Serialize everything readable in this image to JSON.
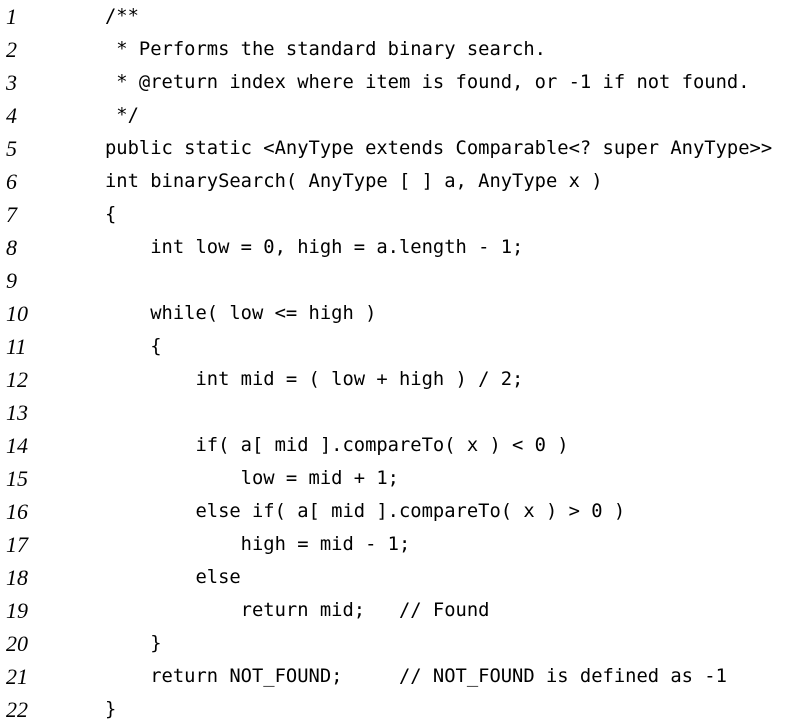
{
  "code_listing": {
    "lines": [
      {
        "number": "1",
        "text": "/**"
      },
      {
        "number": "2",
        "text": " * Performs the standard binary search."
      },
      {
        "number": "3",
        "text": " * @return index where item is found, or -1 if not found."
      },
      {
        "number": "4",
        "text": " */"
      },
      {
        "number": "5",
        "text": "public static <AnyType extends Comparable<? super AnyType>>"
      },
      {
        "number": "6",
        "text": "int binarySearch( AnyType [ ] a, AnyType x )"
      },
      {
        "number": "7",
        "text": "{"
      },
      {
        "number": "8",
        "text": "    int low = 0, high = a.length - 1;"
      },
      {
        "number": "9",
        "text": ""
      },
      {
        "number": "10",
        "text": "    while( low <= high )"
      },
      {
        "number": "11",
        "text": "    {"
      },
      {
        "number": "12",
        "text": "        int mid = ( low + high ) / 2;"
      },
      {
        "number": "13",
        "text": ""
      },
      {
        "number": "14",
        "text": "        if( a[ mid ].compareTo( x ) < 0 )"
      },
      {
        "number": "15",
        "text": "            low = mid + 1;"
      },
      {
        "number": "16",
        "text": "        else if( a[ mid ].compareTo( x ) > 0 )"
      },
      {
        "number": "17",
        "text": "            high = mid - 1;"
      },
      {
        "number": "18",
        "text": "        else"
      },
      {
        "number": "19",
        "text": "            return mid;   // Found"
      },
      {
        "number": "20",
        "text": "    }"
      },
      {
        "number": "21",
        "text": "    return NOT_FOUND;     // NOT_FOUND is defined as -1"
      },
      {
        "number": "22",
        "text": "}"
      }
    ]
  }
}
